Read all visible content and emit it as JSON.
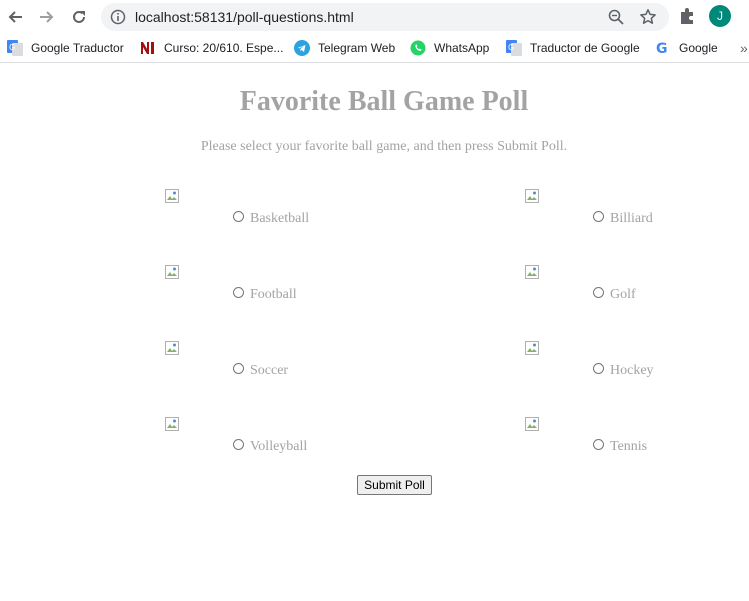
{
  "browser": {
    "url": "localhost:58131/poll-questions.html",
    "profile_initial": "J",
    "accent_color": "#00897b",
    "bookmarks": [
      {
        "label": "Google Traductor",
        "icon": "google-translate-icon"
      },
      {
        "label": "Curso: 20/610. Espe...",
        "icon": "ni-logo-icon"
      },
      {
        "label": "Telegram Web",
        "icon": "telegram-icon"
      },
      {
        "label": "WhatsApp",
        "icon": "whatsapp-icon"
      },
      {
        "label": "Traductor de Google",
        "icon": "google-translate-icon"
      },
      {
        "label": "Google",
        "icon": "google-icon"
      }
    ]
  },
  "page": {
    "title": "Favorite Ball Game Poll",
    "subtitle": "Please select your favorite ball game, and then press Submit Poll.",
    "text_color": "#a3a3a3",
    "options": [
      {
        "label": "Basketball"
      },
      {
        "label": "Billiard"
      },
      {
        "label": "Football"
      },
      {
        "label": "Golf"
      },
      {
        "label": "Soccer"
      },
      {
        "label": "Hockey"
      },
      {
        "label": "Volleyball"
      },
      {
        "label": "Tennis"
      }
    ],
    "submit_label": "Submit Poll"
  }
}
